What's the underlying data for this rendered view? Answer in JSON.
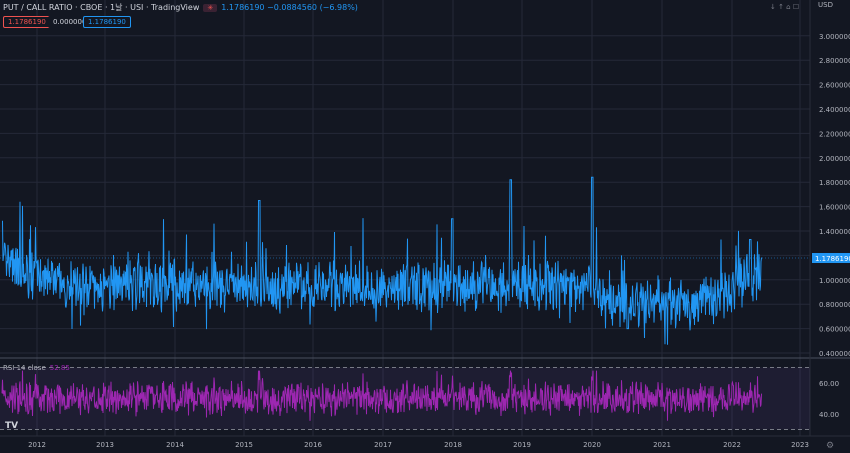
{
  "header": {
    "symbol": "PUT / CALL RATIO · CBOE · 1날 · USI · TradingView",
    "chip_label": "✳",
    "values": "1.1786190  −0.0884560 (−6.98%)"
  },
  "tags": {
    "red": "1.1786190",
    "plain": "0.0000000",
    "blue": "1.1786190"
  },
  "price_scale": {
    "currency": "USD",
    "ticks": [
      "3.0000000",
      "2.8000000",
      "2.6000000",
      "2.4000000",
      "2.2000000",
      "2.0000000",
      "1.8000000",
      "1.6000000",
      "1.4000000",
      "1.2000000",
      "1.0000000",
      "0.8000000",
      "0.6000000",
      "0.4000000"
    ],
    "last_price": "1.1786190"
  },
  "rsi": {
    "name": "RSI 14 close",
    "value": "52.85",
    "ticks": [
      "60.00",
      "40.00"
    ]
  },
  "time_axis": [
    "2012",
    "2013",
    "2014",
    "2015",
    "2016",
    "2017",
    "2018",
    "2019",
    "2020",
    "2021",
    "2022",
    "2023"
  ],
  "colors": {
    "background": "#131722",
    "line": "#2196f3",
    "rsi": "#9c27b0",
    "grid": "#242938",
    "text": "#b2b5be"
  },
  "icons": {
    "tv": "TV",
    "top_controls": "↓ ↑ ⌂ ☐",
    "settings": "⚙"
  },
  "chart_data": [
    {
      "type": "line",
      "title": "PUT / CALL RATIO · CBOE",
      "x_range": [
        "2011-09",
        "2022-07"
      ],
      "y_range": [
        0.4,
        3.0
      ],
      "y_ticks": [
        0.4,
        0.6,
        0.8,
        1.0,
        1.2,
        1.4,
        1.6,
        1.8,
        2.0,
        2.2,
        2.4,
        2.6,
        2.8,
        3.0
      ],
      "last_value": 1.178619,
      "approx_baseline": 0.95,
      "spikes": [
        {
          "x": "2011-09",
          "y": 1.48
        },
        {
          "x": "2015-05",
          "y": 1.65
        },
        {
          "x": "2018-02",
          "y": 1.5
        },
        {
          "x": "2018-12",
          "y": 1.82
        },
        {
          "x": "2020-02",
          "y": 1.84
        },
        {
          "x": "2020-08",
          "y": 0.6
        },
        {
          "x": "2022-05",
          "y": 1.33
        }
      ]
    },
    {
      "type": "line",
      "title": "RSI 14 close",
      "y_range": [
        30,
        70
      ],
      "y_ticks": [
        40,
        60
      ],
      "bands": [
        30,
        70
      ],
      "last_value": 52.85
    }
  ]
}
